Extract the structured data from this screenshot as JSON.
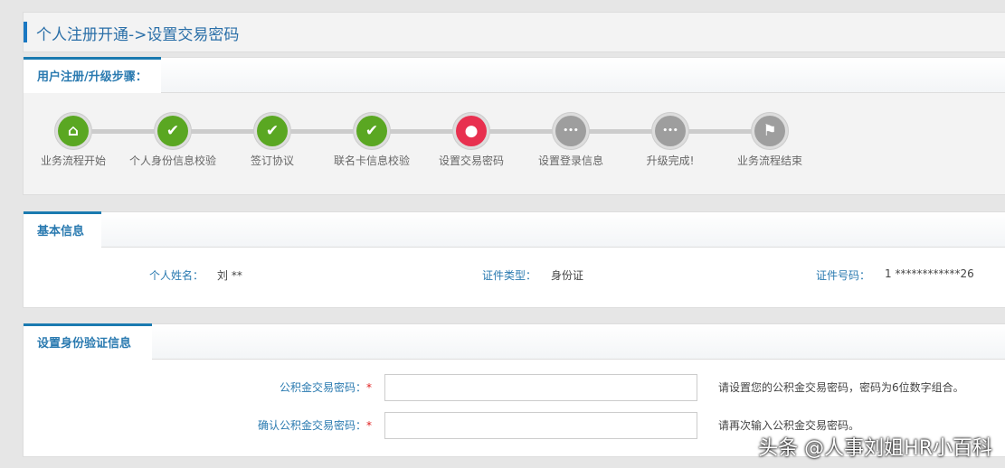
{
  "title": "个人注册开通->设置交易密码",
  "steps_panel": {
    "tab": "用户注册/升级步骤：",
    "steps": [
      {
        "label": "业务流程开始",
        "icon": "home-icon",
        "state": "done"
      },
      {
        "label": "个人身份信息校验",
        "icon": "check-icon",
        "state": "done"
      },
      {
        "label": "签订协议",
        "icon": "check-icon",
        "state": "done"
      },
      {
        "label": "联名卡信息校验",
        "icon": "check-icon",
        "state": "done"
      },
      {
        "label": "设置交易密码",
        "icon": "location-pin-icon",
        "state": "current"
      },
      {
        "label": "设置登录信息",
        "icon": "ellipsis-icon",
        "state": "pending"
      },
      {
        "label": "升级完成!",
        "icon": "ellipsis-icon",
        "state": "pending"
      },
      {
        "label": "业务流程结束",
        "icon": "flag-icon",
        "state": "pending"
      }
    ]
  },
  "info": {
    "tab": "基本信息",
    "name_label": "个人姓名：",
    "name": "刘 **",
    "idtype_label": "证件类型：",
    "idtype": "身份证",
    "idno_label": "证件号码：",
    "idno": "1 ************26"
  },
  "verify": {
    "tab": "设置身份验证信息",
    "pwd_label": "公积金交易密码：",
    "confirm_label": "确认公积金交易密码：",
    "required": "*",
    "pwd_hint": "请设置您的公积金交易密码，密码为6位数字组合。",
    "confirm_hint": "请再次输入公积金交易密码。"
  },
  "watermark": "头条 @人事刘姐HR小百科"
}
